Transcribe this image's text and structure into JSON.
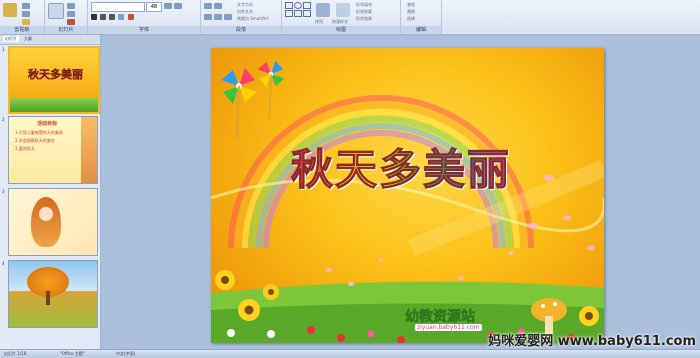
{
  "ribbon": {
    "groups": [
      {
        "label": "剪贴板"
      },
      {
        "label": "幻灯片"
      },
      {
        "label": "字体"
      },
      {
        "label": "段落"
      },
      {
        "label": "绘图"
      },
      {
        "label": "编辑"
      }
    ],
    "font_size_value": "48",
    "paragraph_items": [
      "文字方向",
      "对齐文本",
      "转换为 SmartArt"
    ],
    "drawing_items": [
      "形状填充",
      "形状轮廓",
      "形状效果"
    ],
    "arrange_label": "排列",
    "quick_styles_label": "快速样式",
    "editing_items": [
      "查找",
      "替换",
      "选择"
    ]
  },
  "panel": {
    "tabs": [
      "幻灯片",
      "大纲"
    ],
    "slide_numbers": [
      "1",
      "2",
      "3",
      "4"
    ],
    "thumb1_title": "秋天多美丽",
    "thumb2_title": "活动目标",
    "thumb2_lines": [
      "1.引导儿童感受秋天的美丽",
      "2.学会观察秋天的变化",
      "3.喜欢秋天"
    ]
  },
  "slide": {
    "title": "秋天多美丽",
    "logo_text": "幼教资源站",
    "logo_url": "ziyuan.baby611.com"
  },
  "status": {
    "slide_info": "幻灯片 1/18",
    "theme": "\"Office 主题\"",
    "language": "中文(中国)"
  },
  "watermark": "妈咪爱婴网 www.baby611.com"
}
